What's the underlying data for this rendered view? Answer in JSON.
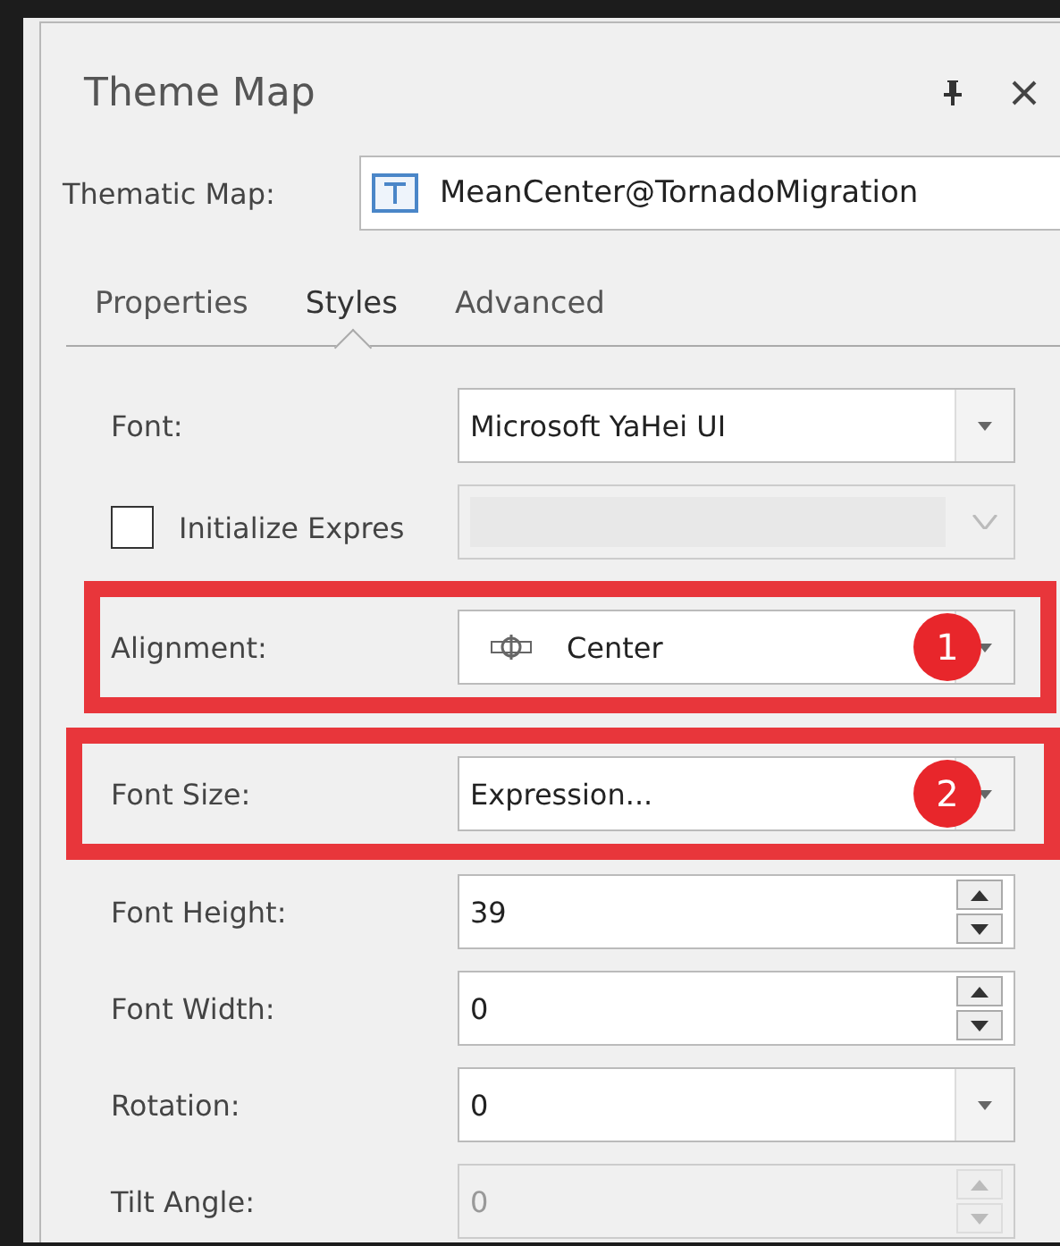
{
  "panel": {
    "title": "Theme Map"
  },
  "thematic_map": {
    "label": "Thematic Map:",
    "value": "MeanCenter@TornadoMigration"
  },
  "tabs": [
    {
      "label": "Properties",
      "selected": false
    },
    {
      "label": "Styles",
      "selected": true
    },
    {
      "label": "Advanced",
      "selected": false
    }
  ],
  "rows": [
    {
      "kind": "combo",
      "label": "Font:",
      "value": "Microsoft YaHei UI",
      "disabled": false
    },
    {
      "kind": "checkbox",
      "label": "Initialize Expres",
      "checked": false,
      "disabled": true
    },
    {
      "kind": "icon-combo",
      "label": "Alignment:",
      "value": "Center",
      "disabled": false,
      "badge": "1"
    },
    {
      "kind": "combo",
      "label": "Font Size:",
      "value": "Expression...",
      "disabled": false,
      "badge": "2"
    },
    {
      "kind": "spinner",
      "label": "Font Height:",
      "value": "39",
      "disabled": false
    },
    {
      "kind": "spinner",
      "label": "Font Width:",
      "value": "0",
      "disabled": false
    },
    {
      "kind": "combo",
      "label": "Rotation:",
      "value": "0",
      "disabled": false
    },
    {
      "kind": "spinner",
      "label": "Tilt Angle:",
      "value": "0",
      "disabled": true
    }
  ]
}
